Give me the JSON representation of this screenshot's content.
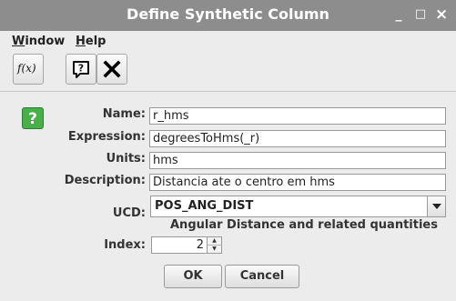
{
  "window": {
    "title": "Define Synthetic Column",
    "minimize_glyph": "_",
    "maximize_glyph": "□",
    "close_glyph": "×"
  },
  "menu": {
    "window_label": "Window",
    "window_mnemonic": "W",
    "window_rest": "indow",
    "help_label": "Help",
    "help_mnemonic": "H",
    "help_rest": "elp"
  },
  "toolbar": {
    "function_icon_text": "f(x)",
    "function_icon": "function-icon",
    "help_icon": "help-bubble-icon",
    "close_icon": "close-x-icon"
  },
  "form": {
    "help_glyph": "?",
    "name_label": "Name:",
    "name_value": "r_hms",
    "expression_label": "Expression:",
    "expression_value": "degreesToHms(_r)",
    "units_label": "Units:",
    "units_value": "hms",
    "description_label": "Description:",
    "description_value": "Distancia ate o centro em hms",
    "ucd_label": "UCD:",
    "ucd_value": "POS_ANG_DIST",
    "ucd_description": "Angular Distance and related quantities",
    "index_label": "Index:",
    "index_value": "2"
  },
  "buttons": {
    "ok": "OK",
    "cancel": "Cancel"
  },
  "colors": {
    "titlebar": "#8d8d8d",
    "help_green": "#47b047",
    "background": "#ececec"
  }
}
